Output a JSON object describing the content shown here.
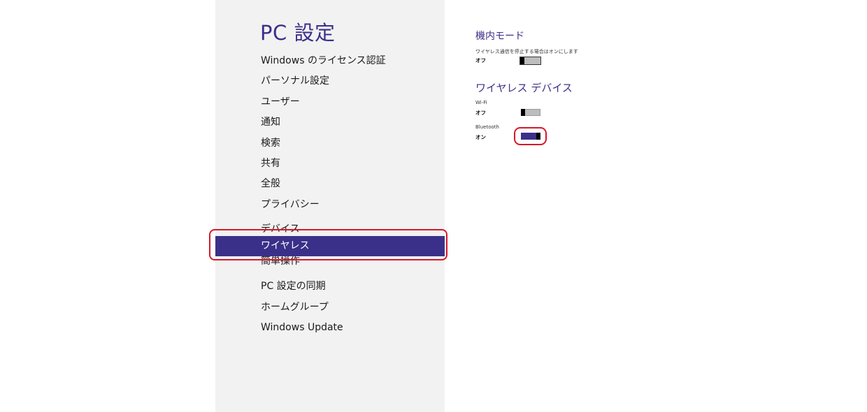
{
  "nav": {
    "title": "PC 設定",
    "items": [
      {
        "label": "Windows のライセンス認証"
      },
      {
        "label": "パーソナル設定"
      },
      {
        "label": "ユーザー"
      },
      {
        "label": "通知"
      },
      {
        "label": "検索"
      },
      {
        "label": "共有"
      },
      {
        "label": "全般"
      },
      {
        "label": "プライバシー"
      },
      {
        "label": "デバイス"
      },
      {
        "label": "ワイヤレス",
        "selected": true
      },
      {
        "label": "簡単操作"
      },
      {
        "label": "PC 設定の同期"
      },
      {
        "label": "ホームグループ"
      },
      {
        "label": "Windows Update"
      }
    ]
  },
  "content": {
    "airplane_mode": {
      "heading": "機内モード",
      "description": "ワイヤレス通信を停止する場合はオンにします",
      "state": "オフ",
      "toggle": "off"
    },
    "wireless_devices": {
      "heading": "ワイヤレス デバイス",
      "wifi": {
        "label": "Wi-Fi",
        "state": "オフ",
        "toggle": "off"
      },
      "bluetooth": {
        "label": "Bluetooth",
        "state": "オン",
        "toggle": "on"
      }
    }
  },
  "colors": {
    "accent": "#3b3089",
    "nav_background": "#f2f2f2",
    "highlight": "#d7182a"
  }
}
